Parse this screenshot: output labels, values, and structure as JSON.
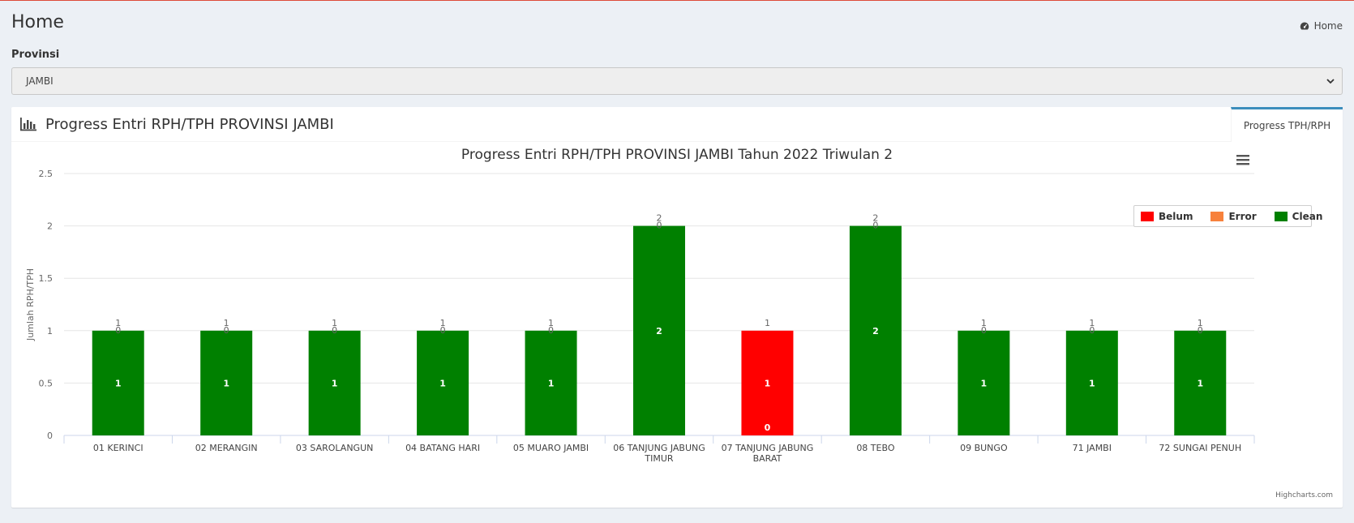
{
  "page": {
    "title": "Home",
    "breadcrumb": "Home"
  },
  "filter": {
    "label": "Provinsi",
    "selected": "JAMBI"
  },
  "box": {
    "title": "Progress Entri RPH/TPH PROVINSI JAMBI",
    "tab_label": "Progress TPH/RPH"
  },
  "colors": {
    "belum": "#ff0000",
    "error": "#f7813c",
    "clean": "#008000"
  },
  "chart_data": {
    "type": "bar",
    "stacked": true,
    "title": "Progress Entri RPH/TPH PROVINSI JAMBI Tahun 2022 Triwulan 2",
    "ylabel": "Jumlah RPH/TPH",
    "ylim": [
      0,
      2.5
    ],
    "yticks": [
      "0",
      "0.5",
      "1",
      "1.5",
      "2",
      "2.5"
    ],
    "categories": [
      "01 KERINCI",
      "02 MERANGIN",
      "03 SAROLANGUN",
      "04 BATANG HARI",
      "05 MUARO JAMBI",
      "06 TANJUNG JABUNG TIMUR",
      "07 TANJUNG JABUNG BARAT",
      "08 TEBO",
      "09 BUNGO",
      "71 JAMBI",
      "72 SUNGAI PENUH"
    ],
    "series": [
      {
        "name": "Belum",
        "values": [
          0,
          0,
          0,
          0,
          0,
          0,
          1,
          0,
          0,
          0,
          0
        ]
      },
      {
        "name": "Error",
        "values": [
          0,
          0,
          0,
          0,
          0,
          0,
          0,
          0,
          0,
          0,
          0
        ]
      },
      {
        "name": "Clean",
        "values": [
          1,
          1,
          1,
          1,
          1,
          2,
          0,
          2,
          1,
          1,
          1
        ]
      }
    ],
    "totals": [
      1,
      1,
      1,
      1,
      1,
      2,
      1,
      2,
      1,
      1,
      1
    ],
    "legend": "top-right",
    "grid": true,
    "credits": "Highcharts.com"
  }
}
